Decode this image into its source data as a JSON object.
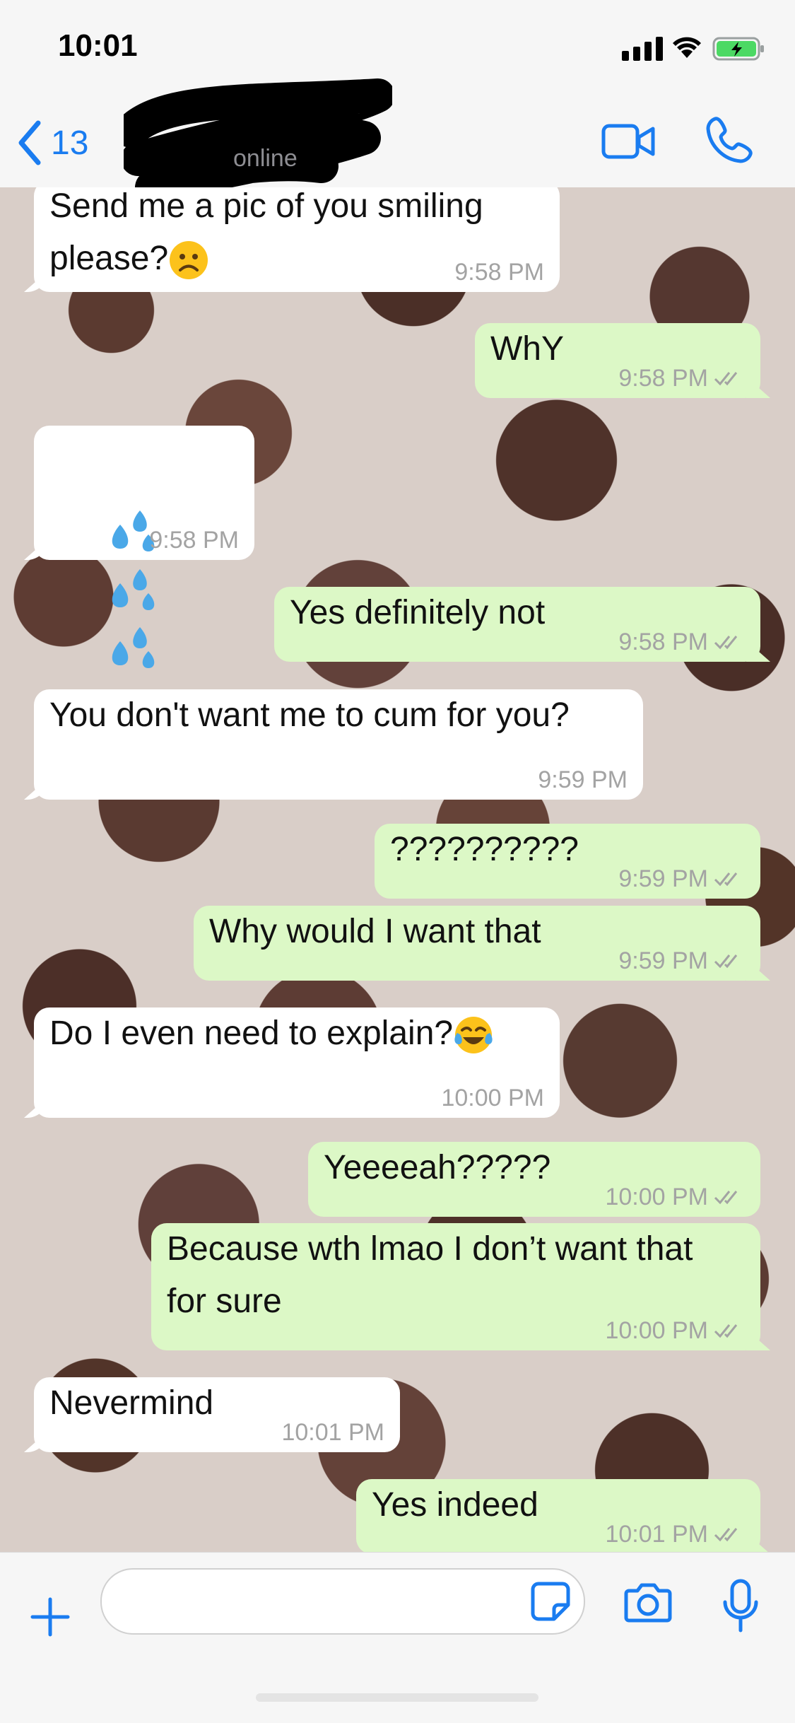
{
  "status_bar": {
    "time": "10:01"
  },
  "nav": {
    "back_count": "13",
    "subtitle": "online"
  },
  "messages": [
    {
      "dir": "in",
      "lines": [
        "Send me a pic of you smiling",
        "please?"
      ],
      "emoji": "frown",
      "time": "9:58 PM"
    },
    {
      "dir": "out",
      "lines": [
        "WhY"
      ],
      "time": "9:58 PM"
    },
    {
      "dir": "in",
      "emoji": "droplets",
      "time": "9:58 PM"
    },
    {
      "dir": "out",
      "lines": [
        "Yes definitely not"
      ],
      "time": "9:58 PM"
    },
    {
      "dir": "in",
      "lines": [
        "You don't want me to cum for you?"
      ],
      "time": "9:59 PM"
    },
    {
      "dir": "out",
      "lines": [
        "??????????"
      ],
      "time": "9:59 PM"
    },
    {
      "dir": "out",
      "lines": [
        "Why would I want that"
      ],
      "time": "9:59 PM"
    },
    {
      "dir": "in",
      "lines": [
        "Do I even need to explain?"
      ],
      "emoji": "laughing",
      "time": "10:00 PM"
    },
    {
      "dir": "out",
      "lines": [
        "Yeeeeah?????"
      ],
      "time": "10:00 PM"
    },
    {
      "dir": "out",
      "lines": [
        "Because wth lmao I don’t want that",
        "for sure"
      ],
      "time": "10:00 PM"
    },
    {
      "dir": "in",
      "lines": [
        "Nevermind"
      ],
      "time": "10:01 PM"
    },
    {
      "dir": "out",
      "lines": [
        "Yes indeed"
      ],
      "time": "10:01 PM"
    }
  ],
  "icons": [
    "back-chevron-icon",
    "video-call-icon",
    "phone-icon",
    "plus-icon",
    "sticker-icon",
    "camera-icon",
    "mic-icon"
  ],
  "colors": {
    "accent": "#1a7cf0",
    "outgoing": "#dcf8c6",
    "incoming": "#ffffff"
  }
}
